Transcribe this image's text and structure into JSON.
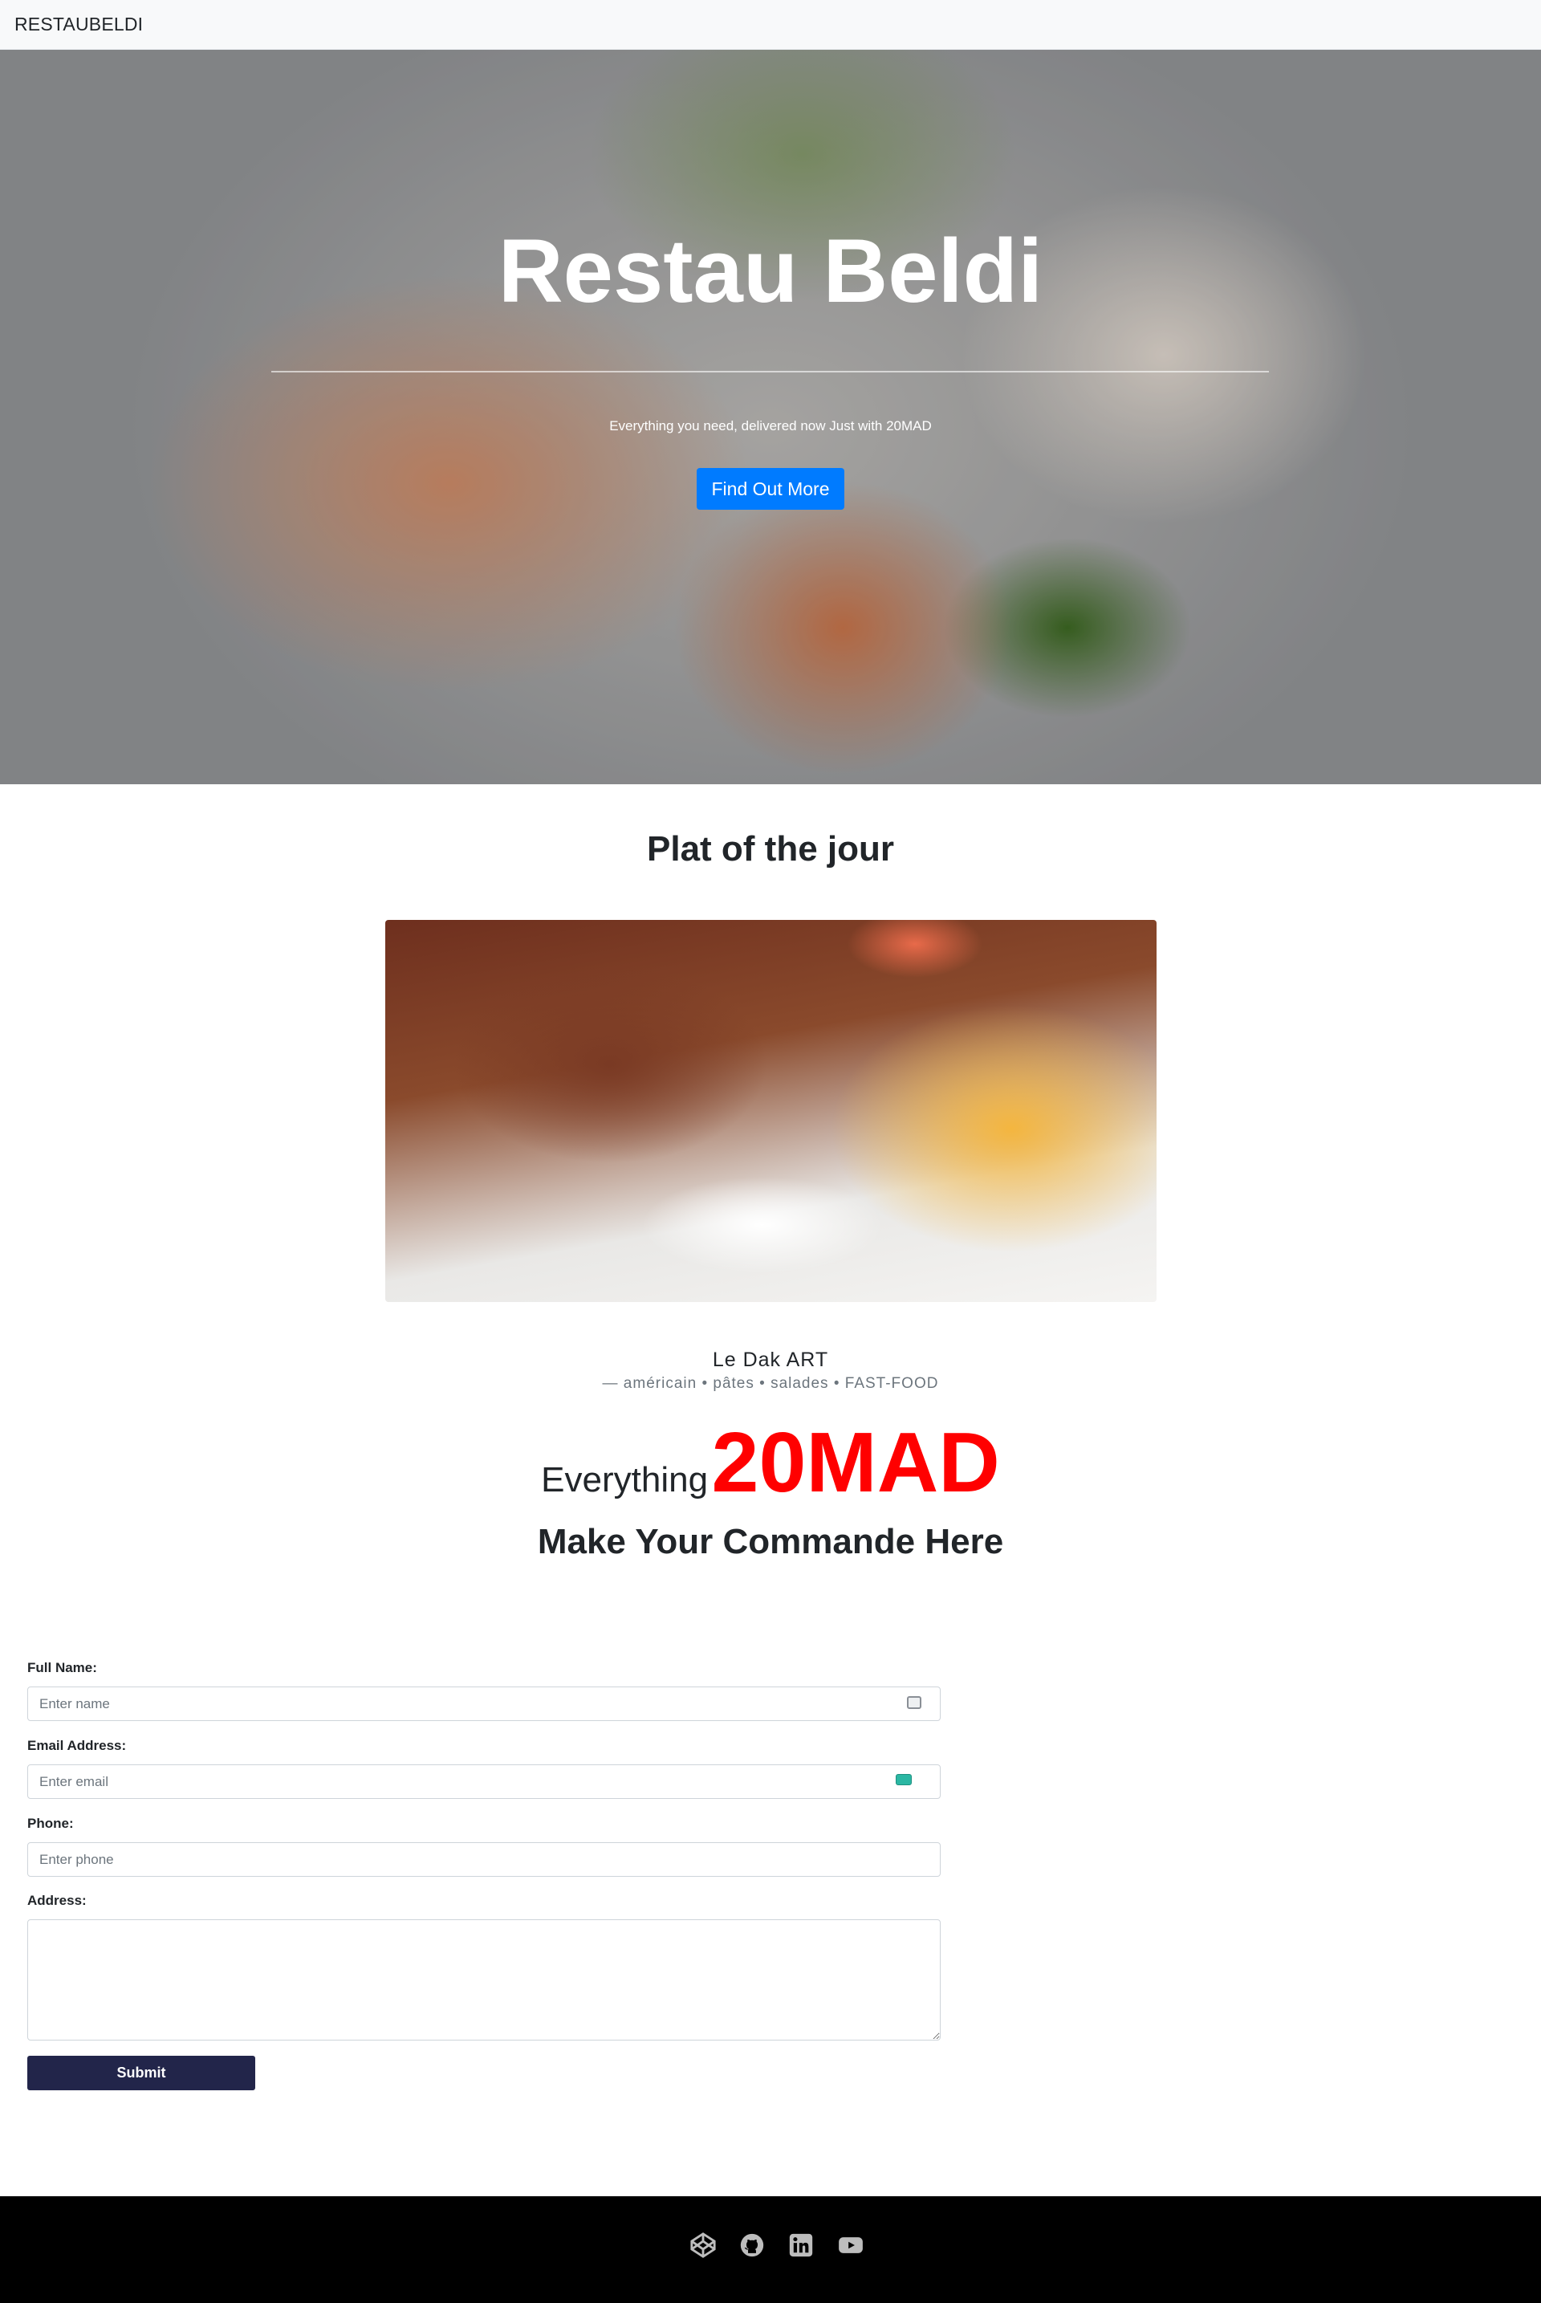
{
  "navbar": {
    "brand": "RESTAUBELDI"
  },
  "hero": {
    "title_bold": "Restau",
    "title_light": "Beldi",
    "subtitle": "Everything you need, delivered now Just with 20MAD",
    "button_label": "Find Out More",
    "button_color": "#007bff"
  },
  "dish": {
    "section_title": "Plat of the jour",
    "restaurant_name": "Le Dak ART",
    "restaurant_tags": "— américain • pâtes • salades • FAST-FOOD"
  },
  "offer": {
    "prefix": "Everything",
    "price": "20MAD",
    "price_color": "#ff0000",
    "call_to_action": "Make Your Commande Here"
  },
  "form": {
    "name_label": "Full Name:",
    "name_placeholder": "Enter name",
    "email_label": "Email Address:",
    "email_placeholder": "Enter email",
    "phone_label": "Phone:",
    "phone_placeholder": "Enter phone",
    "address_label": "Address:",
    "submit_label": "Submit",
    "submit_color": "#22254a"
  },
  "footer": {
    "icons": [
      "codepen-icon",
      "github-icon",
      "linkedin-icon",
      "youtube-icon"
    ]
  }
}
